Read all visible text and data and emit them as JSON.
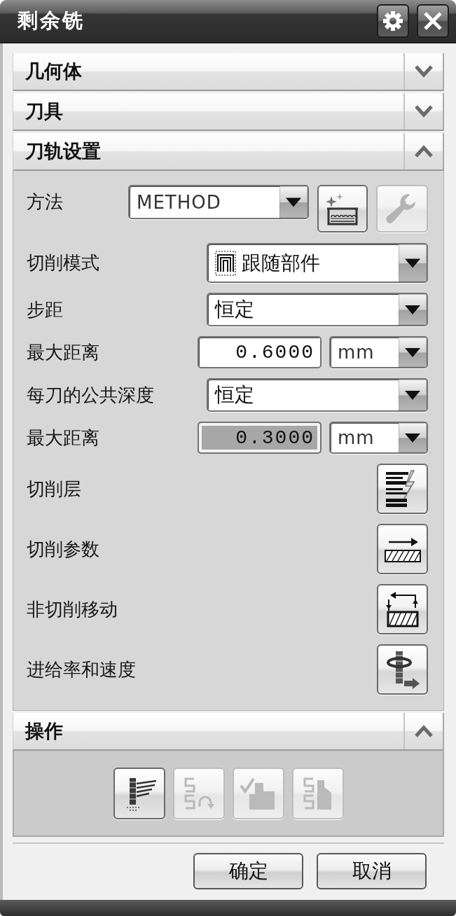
{
  "window": {
    "title": "剩余铣"
  },
  "sections": [
    {
      "title": "几何体",
      "expanded": false
    },
    {
      "title": "刀具",
      "expanded": false
    },
    {
      "title": "刀轨设置",
      "expanded": true,
      "fields": [
        {
          "kind": "method",
          "label": "方法",
          "value": "METHOD",
          "buttons": [
            {
              "disabled": false
            },
            {
              "disabled": true
            }
          ]
        },
        {
          "kind": "select",
          "label": "切削模式",
          "value": "跟随部件",
          "icon": true
        },
        {
          "kind": "select",
          "label": "步距",
          "value": "恒定"
        },
        {
          "kind": "number",
          "label": "最大距离",
          "value": "0.6000",
          "unit": "mm",
          "disabled": false
        },
        {
          "kind": "select",
          "label": "每刀的公共深度",
          "value": "恒定"
        },
        {
          "kind": "number",
          "label": "最大距离",
          "value": "0.3000",
          "unit": "mm",
          "disabled": true
        },
        {
          "kind": "action",
          "label": "切削层"
        },
        {
          "kind": "action",
          "label": "切削参数"
        },
        {
          "kind": "action",
          "label": "非切削移动"
        },
        {
          "kind": "action",
          "label": "进给率和速度"
        }
      ]
    },
    {
      "title": "操作",
      "expanded": true,
      "actions": [
        {
          "disabled": false
        },
        {
          "disabled": true
        },
        {
          "disabled": true
        },
        {
          "disabled": true
        }
      ]
    }
  ],
  "buttons": [
    {
      "label": "确定"
    },
    {
      "label": "取消"
    }
  ]
}
